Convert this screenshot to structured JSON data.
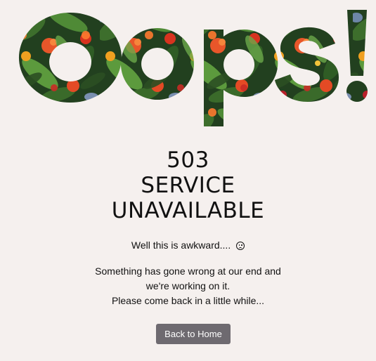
{
  "hero": {
    "text": "Oops!"
  },
  "status": {
    "line1": "503",
    "line2": "SERVICE",
    "line3": "UNAVAILABLE"
  },
  "awkward": {
    "text": "Well this is awkward....",
    "icon": "frown-face-icon"
  },
  "message": {
    "line1": "Something has gone wrong at our end and",
    "line2": "we're working on it.",
    "line3": "Please come back in a little while..."
  },
  "button": {
    "label": "Back to Home"
  },
  "colors": {
    "background": "#f5f0ee",
    "button": "#6e6a70",
    "text": "#111111"
  }
}
